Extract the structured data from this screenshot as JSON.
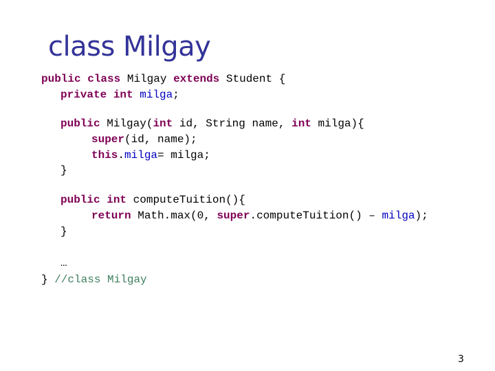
{
  "slide": {
    "title": "class Milgay",
    "page_number": "3"
  },
  "code": {
    "l1": {
      "kw_public": "public",
      "kw_class": "class",
      "name": "Milgay",
      "kw_extends": "extends",
      "rest": "Student {"
    },
    "l2": {
      "kw_private": "private",
      "kw_int": "int",
      "field": "milga",
      "semi": ";"
    },
    "l3": {
      "kw_public": "public",
      "sig_a": "Milgay(",
      "kw_int1": "int",
      "sig_b": "id, String name,",
      "kw_int2": "int",
      "sig_c": "milga){"
    },
    "l4": {
      "kw_super": "super",
      "rest": "(id, name);"
    },
    "l5": {
      "kw_this": "this",
      "dot": ".",
      "field": "milga",
      "rest": "= milga;"
    },
    "l6": "}",
    "l7": {
      "kw_public": "public",
      "kw_int": "int",
      "rest": "computeTuition(){"
    },
    "l8": {
      "kw_return": "return",
      "mid": "Math.max(0,",
      "kw_super": "super",
      "rest_a": ".computeTuition() –",
      "field": "milga",
      "rest_b": ");"
    },
    "l9": "}",
    "l10": "…",
    "l11": {
      "brace": "}",
      "comment": "//class Milgay"
    }
  }
}
